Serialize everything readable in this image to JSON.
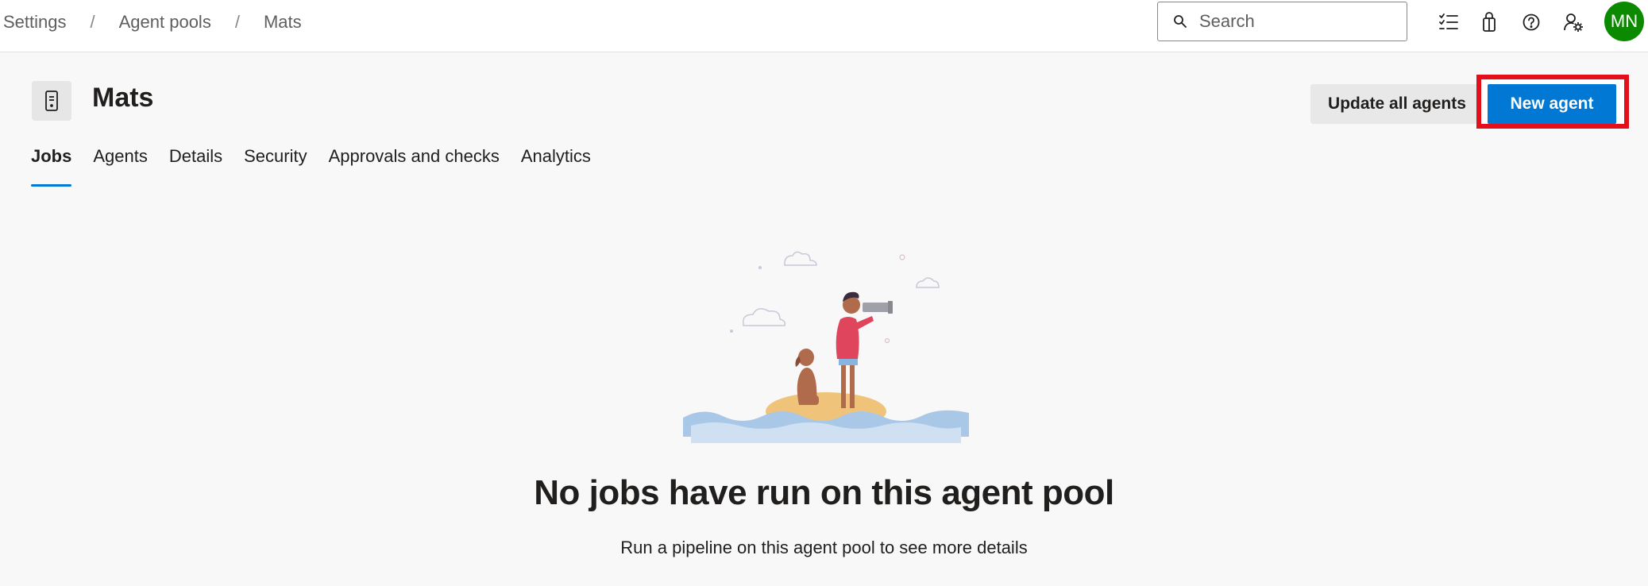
{
  "breadcrumb": {
    "items": [
      "Settings",
      "Agent pools",
      "Mats"
    ],
    "separator": "/"
  },
  "search": {
    "placeholder": "Search"
  },
  "toolbar_icons": [
    "work-items-icon",
    "marketplace-bag-icon",
    "help-icon",
    "user-settings-icon"
  ],
  "user": {
    "initials": "MN",
    "avatar_color": "#0b8a00"
  },
  "header": {
    "title": "Mats",
    "update_all_label": "Update all agents",
    "new_agent_label": "New agent"
  },
  "tabs": [
    {
      "label": "Jobs",
      "active": true
    },
    {
      "label": "Agents",
      "active": false
    },
    {
      "label": "Details",
      "active": false
    },
    {
      "label": "Security",
      "active": false
    },
    {
      "label": "Approvals and checks",
      "active": false
    },
    {
      "label": "Analytics",
      "active": false
    }
  ],
  "empty_state": {
    "title": "No jobs have run on this agent pool",
    "subtitle": "Run a pipeline on this agent pool to see more details"
  },
  "colors": {
    "accent": "#0078d4",
    "highlight_border": "#e3101c",
    "avatar": "#0b8a00"
  }
}
